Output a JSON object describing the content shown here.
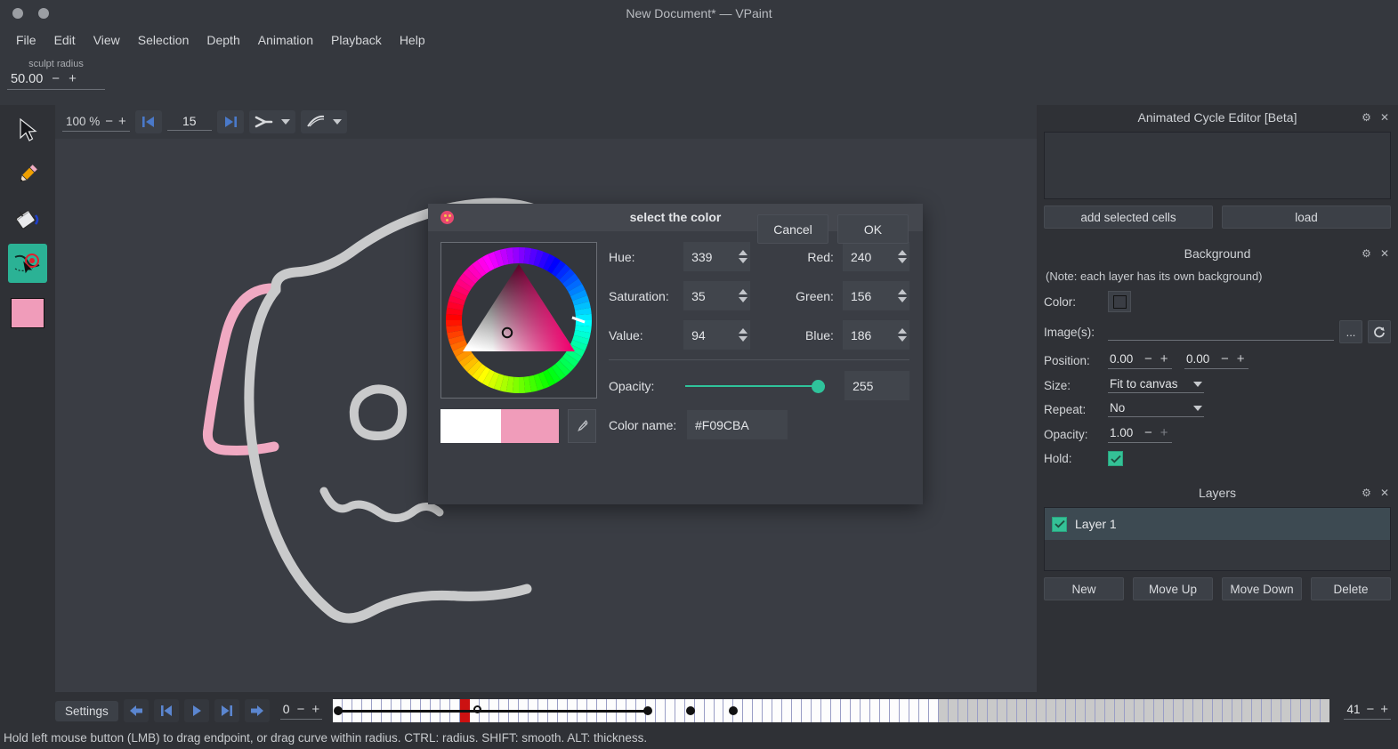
{
  "window": {
    "title": "New Document* — VPaint",
    "dots": [
      "minimize-dot",
      "maximize-dot"
    ]
  },
  "menubar": {
    "items": [
      "File",
      "Edit",
      "View",
      "Selection",
      "Depth",
      "Animation",
      "Playback",
      "Help"
    ]
  },
  "toolbar_top": {
    "sculpt_radius_label": "sculpt radius",
    "sculpt_radius_value": "50.00",
    "minus": "−",
    "plus": "+"
  },
  "tools": [
    {
      "name": "select-tool",
      "icon": "cursor-arrow-icon",
      "active": false
    },
    {
      "name": "pencil-tool",
      "icon": "pencil-icon",
      "active": false
    },
    {
      "name": "paint-bucket-tool",
      "icon": "paint-bucket-icon",
      "active": false
    },
    {
      "name": "sculpt-tool",
      "icon": "sculpt-curve-icon",
      "active": true
    },
    {
      "name": "color-swatch-tool",
      "icon": "color-swatch-icon",
      "active": false,
      "color": "#F09CBA"
    }
  ],
  "canvas_toolbar": {
    "zoom_value": "100 %",
    "zoom_minus": "−",
    "zoom_plus": "+",
    "first_frame_icon": "skip-to-start-icon",
    "onion_value": "15",
    "last_frame_icon": "skip-to-end-icon",
    "edge_mode_icon": "edge-join-icon",
    "stroke_mode_icon": "stroke-style-icon",
    "dropdown_icon": "chevron-down-icon"
  },
  "canvas": {
    "background": "#3a3d44",
    "stroke_gray": "#c9cacb",
    "stroke_pink": "#f0a9c2"
  },
  "dialog": {
    "title": "select the color",
    "icon": "color-palette-icon",
    "hue": {
      "label": "Hue:",
      "value": "339"
    },
    "saturation": {
      "label": "Saturation:",
      "value": "35"
    },
    "value": {
      "label": "Value:",
      "value": "94"
    },
    "red": {
      "label": "Red:",
      "value": "240"
    },
    "green": {
      "label": "Green:",
      "value": "156"
    },
    "blue": {
      "label": "Blue:",
      "value": "186"
    },
    "opacity": {
      "label": "Opacity:",
      "value": "255",
      "slider_percent": 100
    },
    "color_name": {
      "label": "Color name:",
      "value": "#F09CBA"
    },
    "preview_old": "#FFFFFF",
    "preview_new": "#F09CBA",
    "picker_icon": "eyedropper-icon",
    "cancel_label": "Cancel",
    "ok_label": "OK",
    "accent": "#2fc39b"
  },
  "dock": {
    "animated_cycle_editor": {
      "title": "Animated Cycle Editor [Beta]",
      "settings_icon": "gear-icon",
      "close_icon": "close-icon",
      "add_cells_label": "add selected cells",
      "load_label": "load"
    },
    "background": {
      "title": "Background",
      "settings_icon": "gear-icon",
      "close_icon": "close-icon",
      "note": "(Note: each layer has its own background)",
      "color_label": "Color:",
      "images_label": "Image(s):",
      "images_value": "",
      "browse_label": "...",
      "refresh_icon": "refresh-icon",
      "position_label": "Position:",
      "position_x": "0.00",
      "position_y": "0.00",
      "size_label": "Size:",
      "size_value": "Fit to canvas",
      "repeat_label": "Repeat:",
      "repeat_value": "No",
      "opacity_label": "Opacity:",
      "opacity_value": "1.00",
      "hold_label": "Hold:",
      "hold_checked": true,
      "minus": "−",
      "plus": "+"
    },
    "layers": {
      "title": "Layers",
      "settings_icon": "gear-icon",
      "close_icon": "close-icon",
      "items": [
        {
          "name": "Layer 1",
          "visible": true
        }
      ],
      "buttons": [
        "New",
        "Move Up",
        "Move Down",
        "Delete"
      ]
    }
  },
  "bottombar": {
    "settings_label": "Settings",
    "playback_buttons": [
      "step-back-icon",
      "jump-to-start-icon",
      "play-icon",
      "jump-to-end-icon",
      "step-forward-icon"
    ],
    "frame_value": "0",
    "frame_minus": "−",
    "frame_plus": "+",
    "end_frame_value": "41",
    "end_minus": "−",
    "end_plus": "+",
    "timeline": {
      "total_cells": 102,
      "active_cells": 62,
      "playhead_index": 13,
      "keyframes": [
        0,
        29,
        33,
        37
      ],
      "line_from": 0,
      "line_to": 29
    }
  },
  "statusbar": {
    "text": "Hold left mouse button (LMB) to drag endpoint, or drag curve within radius. CTRL: radius. SHIFT: smooth. ALT: thickness."
  }
}
